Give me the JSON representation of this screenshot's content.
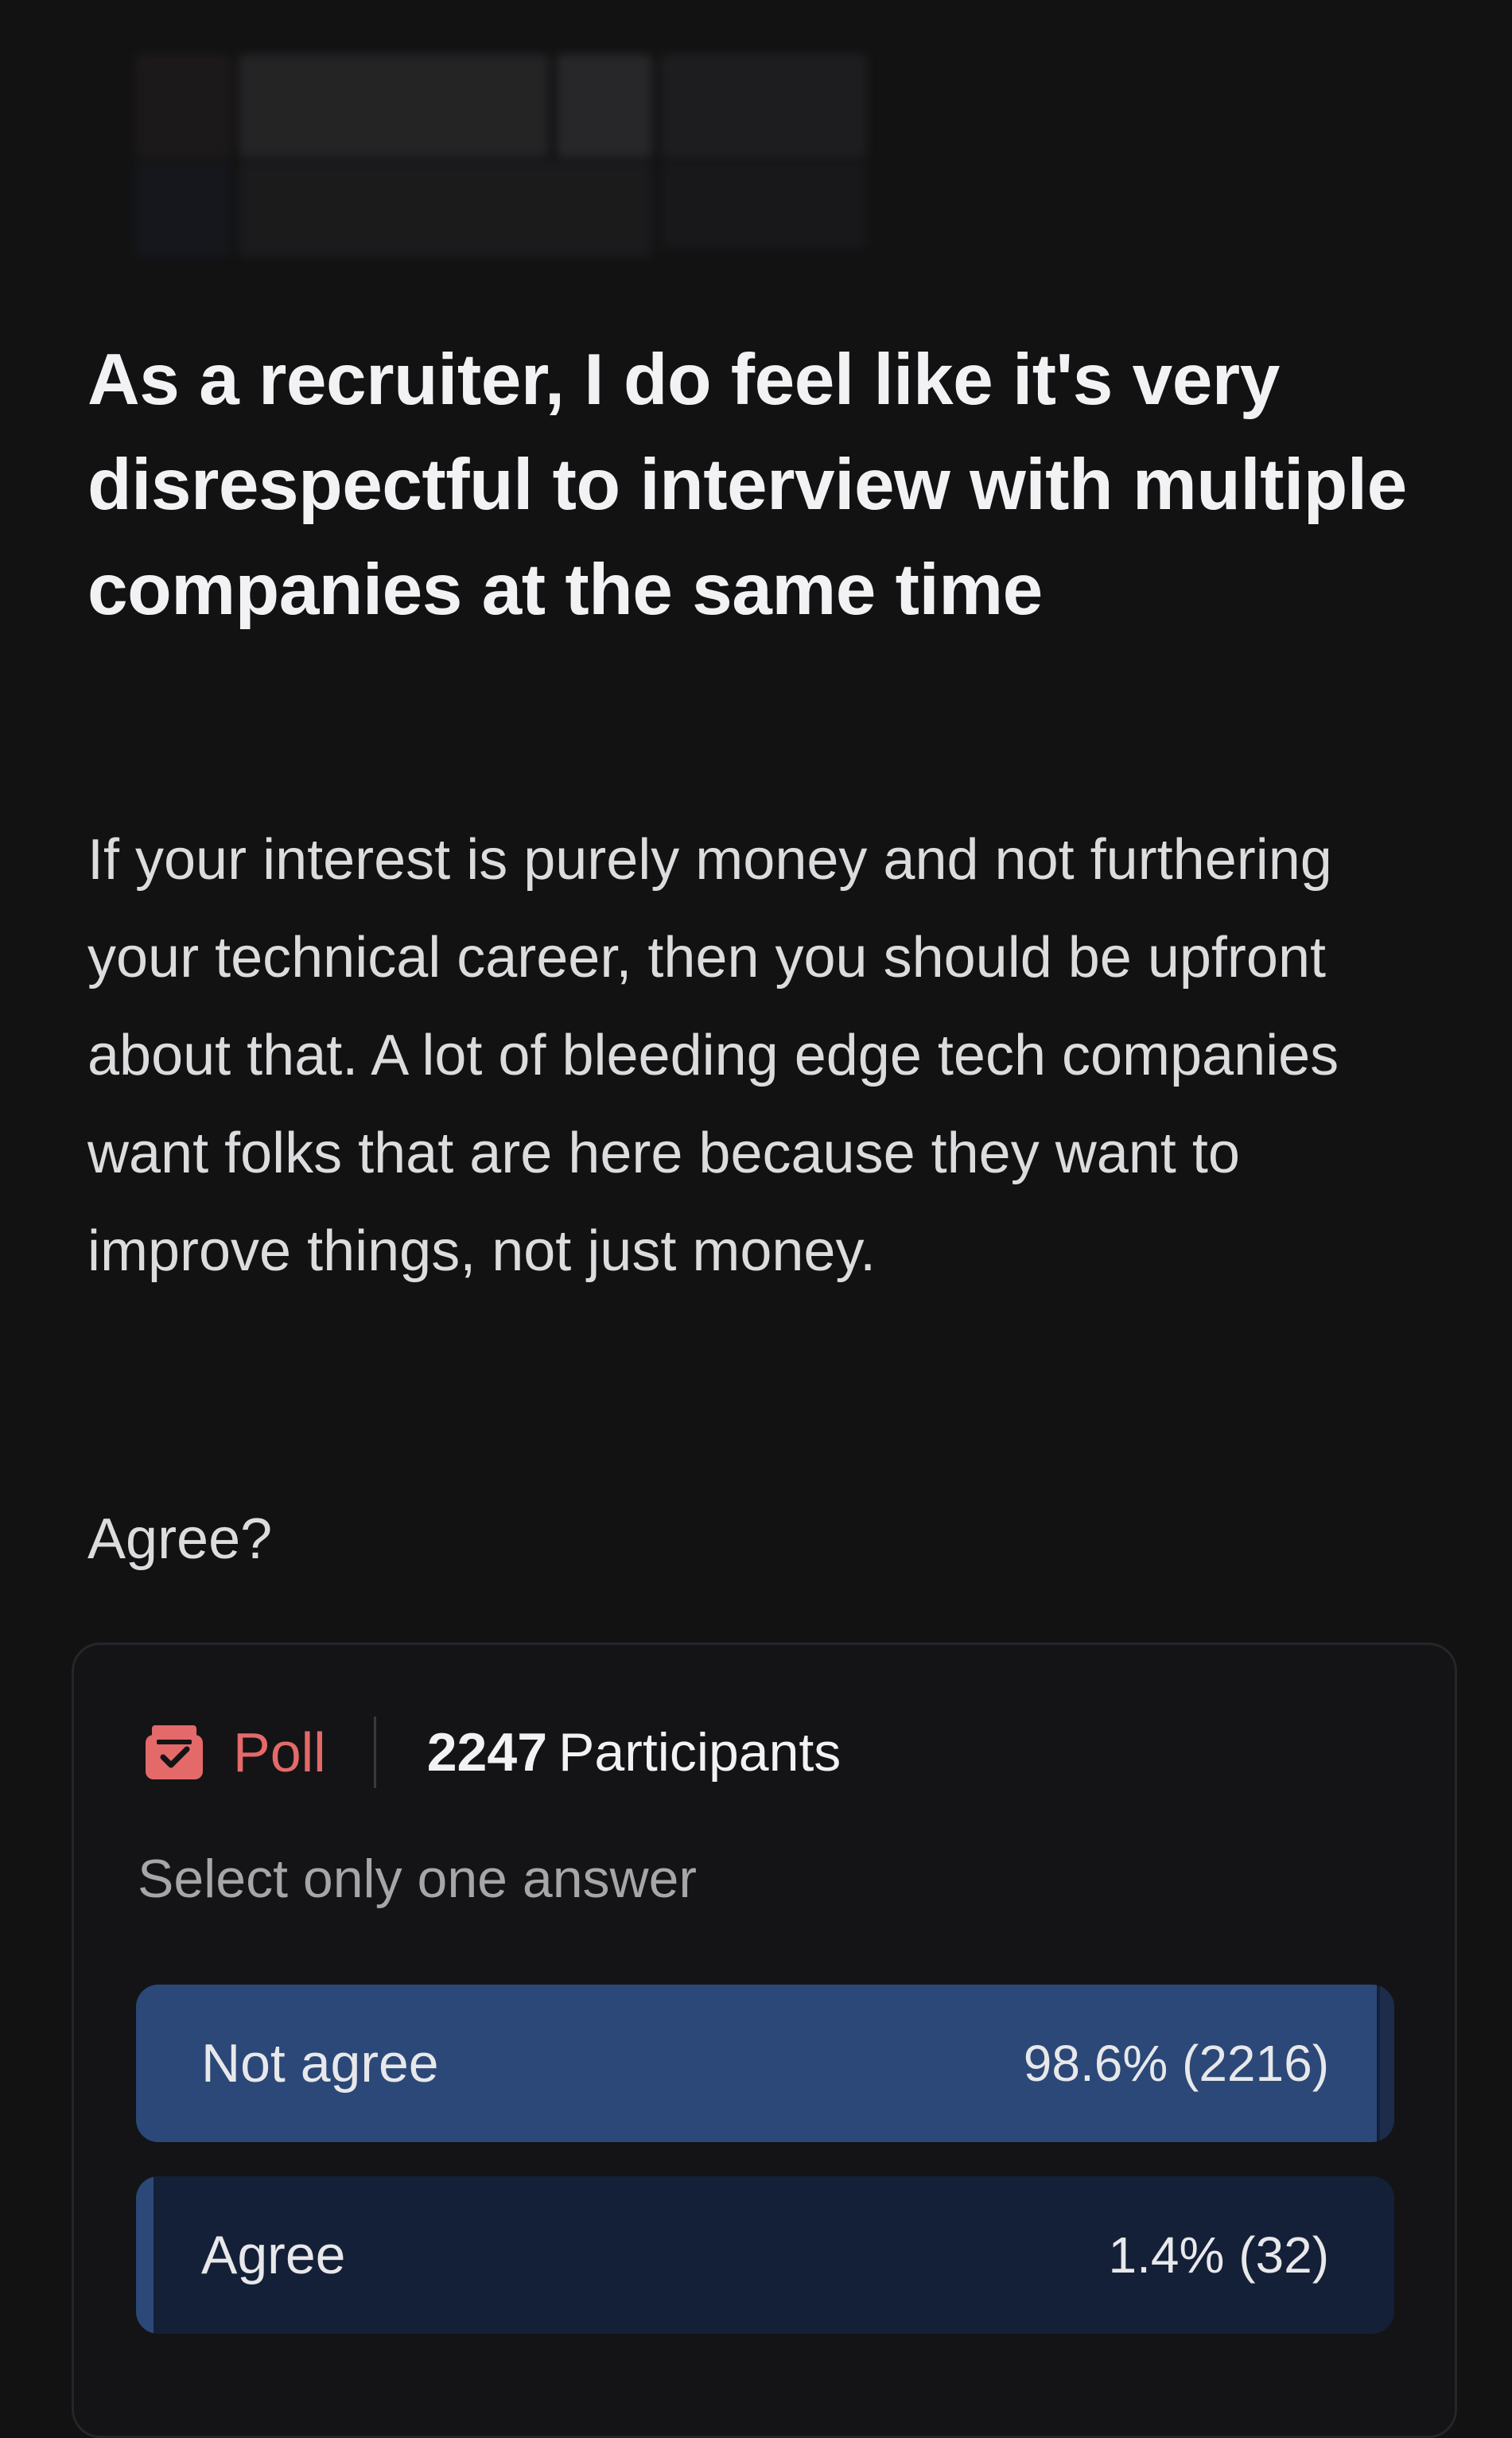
{
  "post": {
    "title": "As a recruiter, I do feel like it's very disrespectful to interview with multiple companies at the same time",
    "body": "If your interest is purely money and not furthering your technical career, then you should be upfront about that. A lot of bleeding edge tech companies want folks that are here because they want to improve things, not just money.",
    "question": "Agree?"
  },
  "poll": {
    "icon": "ballot-box-icon",
    "label": "Poll",
    "participants_count": "2247",
    "participants_label": "Participants",
    "instruction": "Select only one answer",
    "options": [
      {
        "label": "Not agree",
        "result": "98.6% (2216)",
        "percent": 98.6
      },
      {
        "label": "Agree",
        "result": "1.4% (32)",
        "percent": 1.4
      }
    ]
  },
  "colors": {
    "background": "#121213",
    "poll_accent": "#e46a6a",
    "bar_fill": "#2b4878",
    "bar_track": "#142038"
  }
}
